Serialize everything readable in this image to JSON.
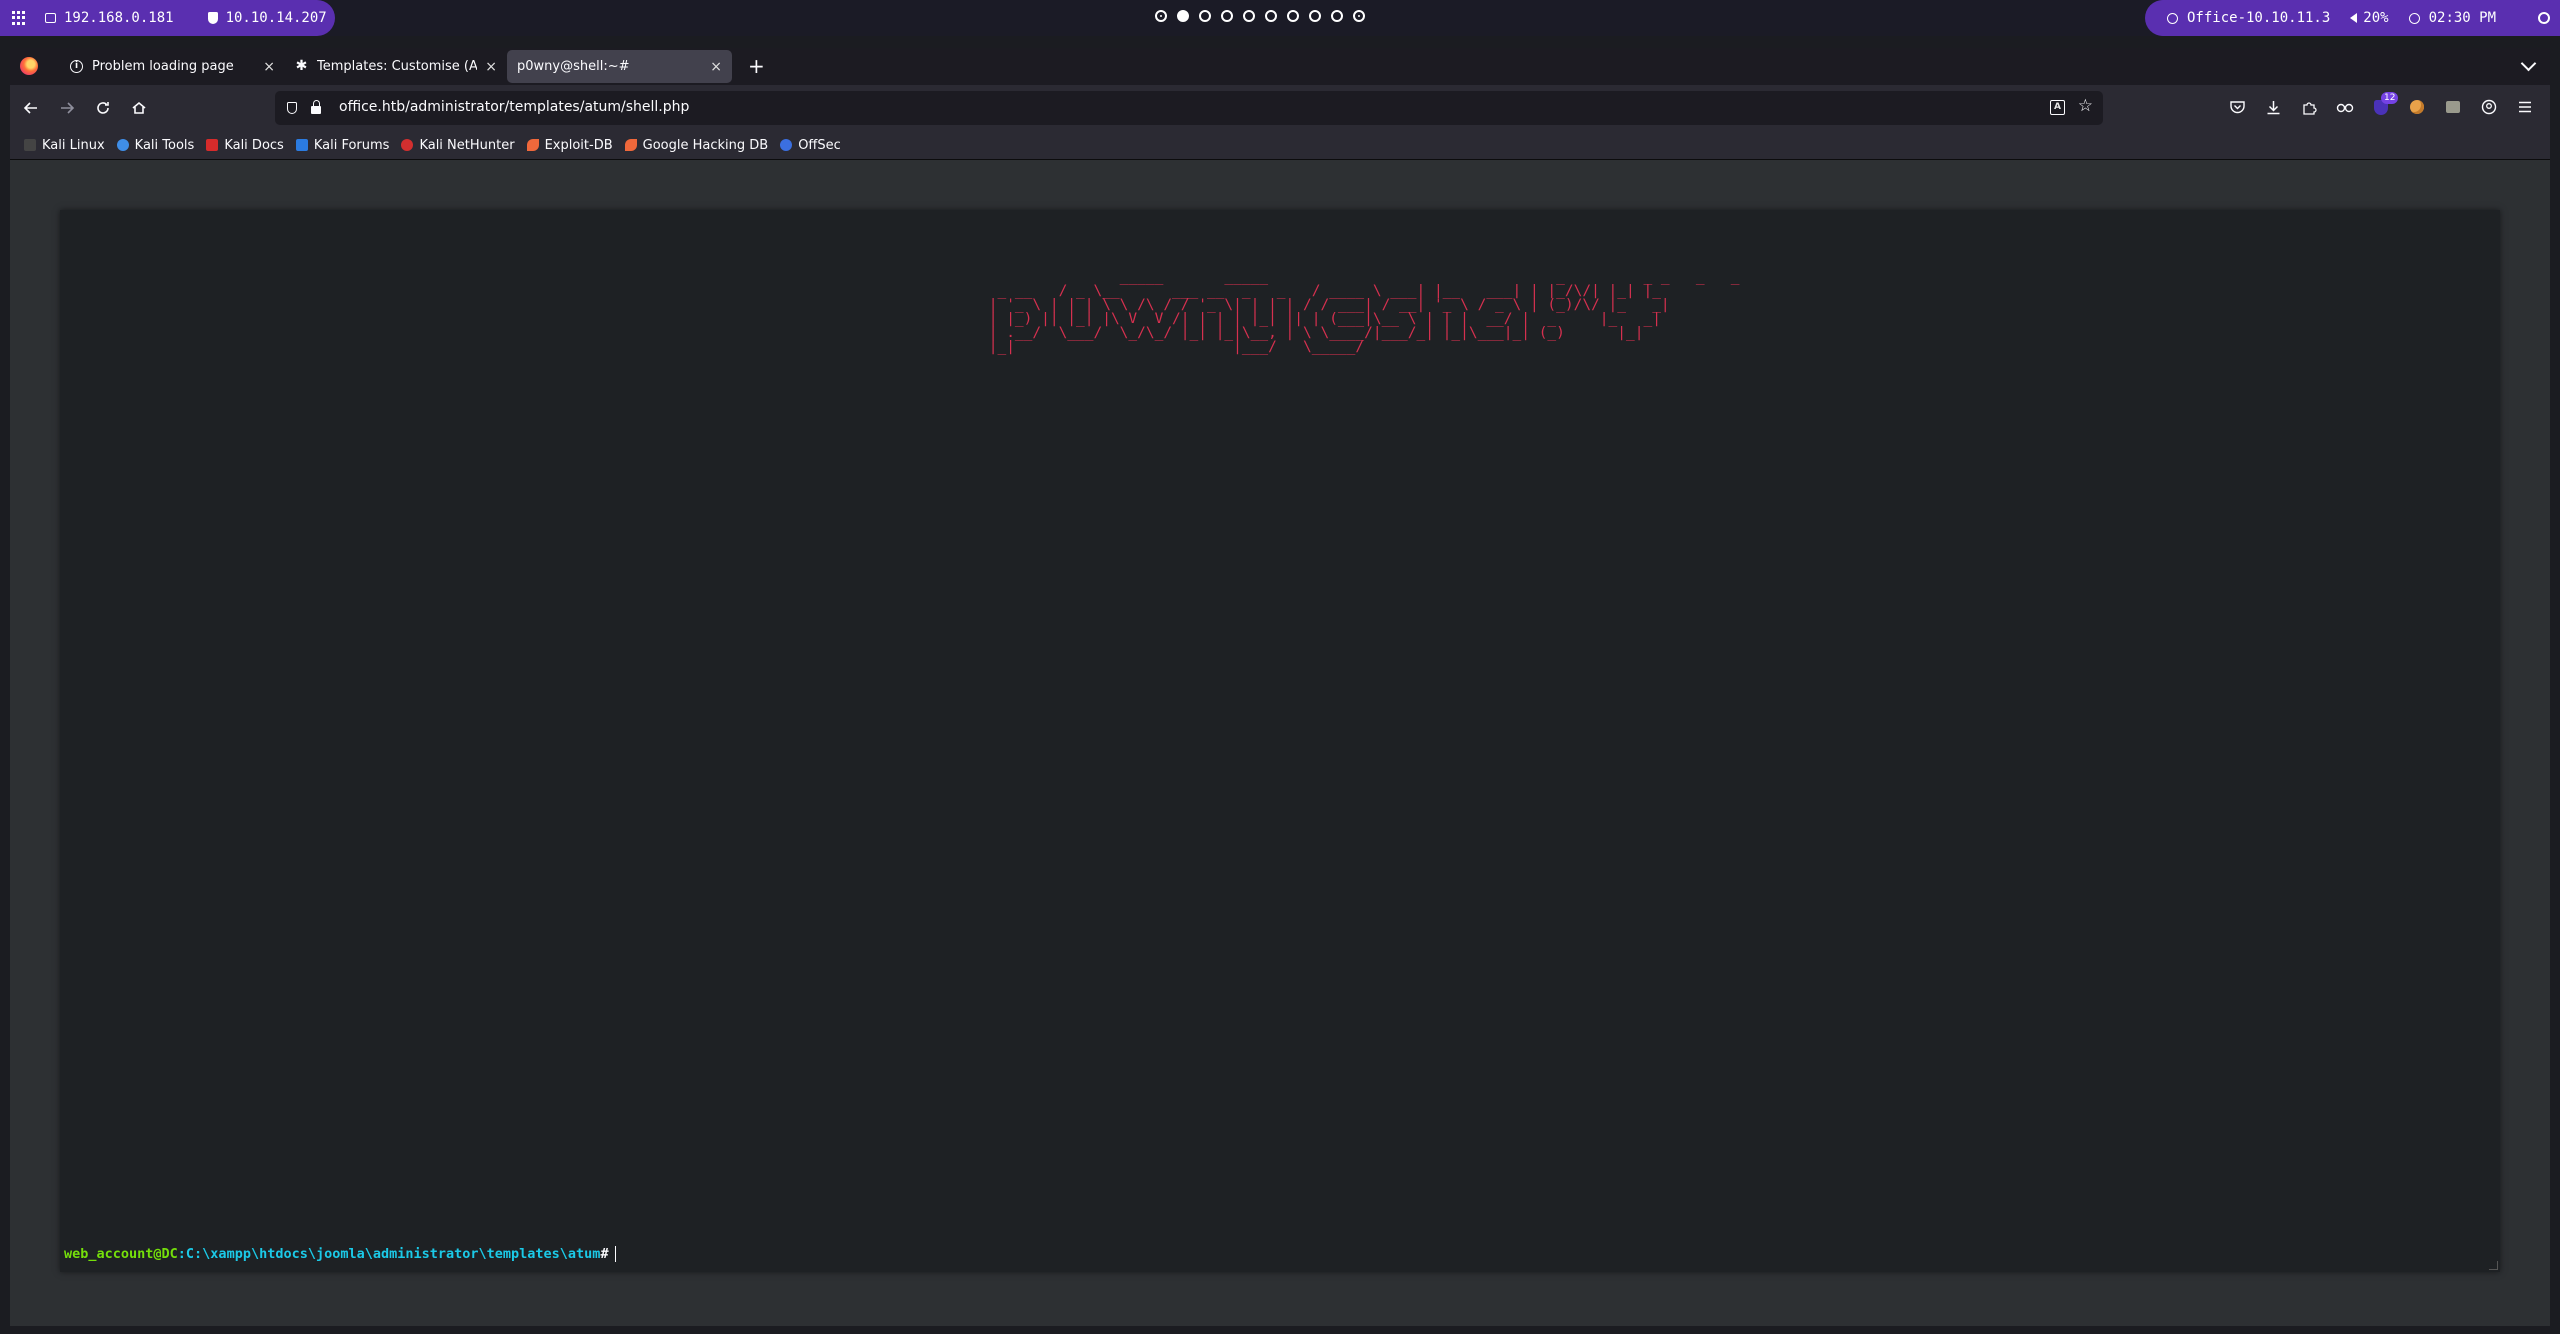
{
  "panel": {
    "ip_local": "192.168.0.181",
    "ip_vpn": "10.10.14.207",
    "target": "Office-10.10.11.3",
    "volume": "20%",
    "time": "02:30 PM"
  },
  "tabs": [
    {
      "title": "Problem loading page",
      "close": "×"
    },
    {
      "title": "Templates: Customise (Atu",
      "close": "×"
    },
    {
      "title": "p0wny@shell:~#",
      "close": "×"
    }
  ],
  "newtab_label": "+",
  "urlbar": {
    "url": "office.htb/administrator/templates/atum/shell.php"
  },
  "toolbar": {
    "extension_badge": "12"
  },
  "bookmarks": [
    {
      "label": "Kali Linux",
      "color": "#367bf0"
    },
    {
      "label": "Kali Tools",
      "color": "#3f8ee8"
    },
    {
      "label": "Kali Docs",
      "color": "#d62b2b"
    },
    {
      "label": "Kali Forums",
      "color": "#2b7be0"
    },
    {
      "label": "Kali NetHunter",
      "color": "#d32f2f"
    },
    {
      "label": "Exploit-DB",
      "color": "#f0683b"
    },
    {
      "label": "Google Hacking DB",
      "color": "#f0683b"
    },
    {
      "label": "OffSec",
      "color": "#3b6fe0"
    }
  ],
  "terminal": {
    "banner": "                _____       _____                                 _         _ _   _   _\n  _ __   / _ \\__      ___ __  _   _   / ____ \\ ___| |__   ___| | |_/\\/| |_| |_\n | '_ \\ | | | \\ \\ /\\ / / '_ \\| | | | / / ___| / __| '_ \\ / _ \\ | (_)/\\/ |_   _|\n | |_) || |_| |\\ V  V /| | | | |_| || | (___|\\__ \\ | | |  __/ |  _     |_   _|\n | .__/  \\___/  \\_/\\_/ |_| |_|\\__, | \\ \\____/|___/_| |_|\\___|_| (_)      |_|\n |_|                         |___/   \\_____/",
    "prompt_user": "web_account@DC",
    "prompt_path": ":C:\\xampp\\htdocs\\joomla\\administrator\\templates\\atum",
    "prompt_symbol": "#"
  },
  "colors": {
    "banner": "#d5304f",
    "prompt_user": "#75df0b",
    "prompt_path": "#1bc9e7",
    "panel_accent": "#5a2fb0"
  }
}
